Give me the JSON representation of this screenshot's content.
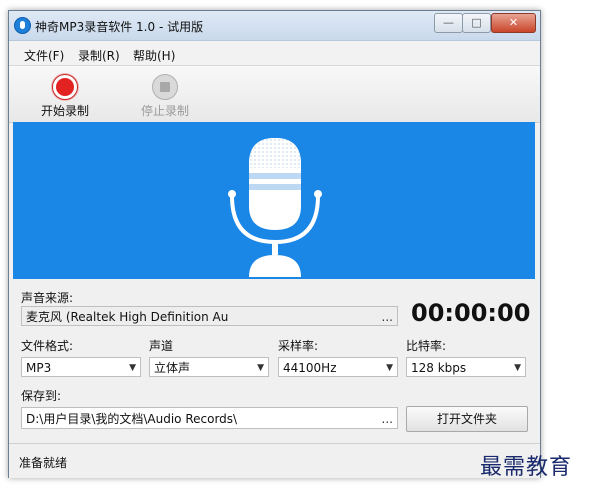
{
  "window": {
    "title": "神奇MP3录音软件 1.0 - 试用版",
    "controls": {
      "minimize": "—",
      "maximize": "□",
      "close": "✕"
    }
  },
  "menu": [
    "文件(F)",
    "录制(R)",
    "帮助(H)"
  ],
  "toolbar": {
    "start_label": "开始录制",
    "start_icon": "record-icon",
    "stop_label": "停止录制",
    "stop_icon": "stop-icon",
    "stop_disabled": true
  },
  "banner": {
    "color": "#1a86e6",
    "icon": "microphone-icon"
  },
  "source": {
    "label": "声音来源:",
    "value": "麦克风 (Realtek High Definition Au",
    "browse": "..."
  },
  "timer": "00:00:00",
  "format": {
    "label": "文件格式:",
    "value": "MP3"
  },
  "channel": {
    "label": "声道",
    "value": "立体声"
  },
  "sample_rate": {
    "label": "采样率:",
    "value": "44100Hz"
  },
  "bitrate": {
    "label": "比特率:",
    "value": "128 kbps"
  },
  "save": {
    "label": "保存到:",
    "value": "D:\\用户目录\\我的文档\\Audio Records\\",
    "browse": "...",
    "open_folder": "打开文件夹"
  },
  "status": "准备就绪",
  "watermark": "最需教育"
}
